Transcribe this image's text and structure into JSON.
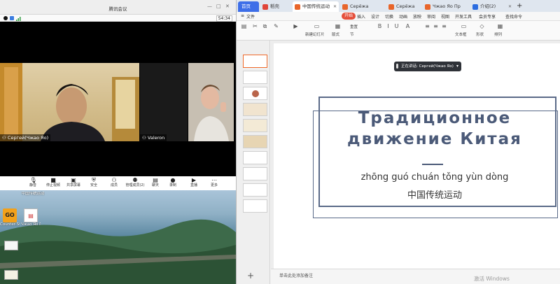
{
  "meeting": {
    "title": "腾讯会议",
    "timer": "54:34",
    "participants": [
      {
        "name": "Сергей(Чжао Яо)"
      },
      {
        "name": "Valeron"
      }
    ],
    "toolbar": [
      {
        "label": "静音",
        "icon": "microphone-icon"
      },
      {
        "label": "停止视频",
        "icon": "camera-icon"
      },
      {
        "label": "共享屏幕",
        "icon": "share-screen-icon"
      },
      {
        "label": "安全",
        "icon": "shield-icon"
      },
      {
        "label": "成员",
        "icon": "members-icon"
      },
      {
        "label": "管理成员(2)",
        "icon": "manage-members-icon"
      },
      {
        "label": "聊天",
        "icon": "chat-icon"
      },
      {
        "label": "录制",
        "icon": "record-icon"
      },
      {
        "label": "直播",
        "icon": "live-icon"
      },
      {
        "label": "更多",
        "icon": "more-icon"
      }
    ]
  },
  "desktop": {
    "icons": [
      {
        "label": "中国传统运动",
        "kind": "ppt-file-icon"
      },
      {
        "label": "Counter-Strike Global Off...",
        "kind": "game-icon"
      },
      {
        "label": "Чжао Яо Проект...",
        "kind": "document-icon"
      }
    ]
  },
  "presentation": {
    "tabs": [
      {
        "label": "首页"
      },
      {
        "label": "稻壳"
      },
      {
        "label": "中国传统运动"
      },
      {
        "label": "Серёжа"
      },
      {
        "label": "Серёжа"
      },
      {
        "label": "Чжао Яо Пр"
      },
      {
        "label": "介绍(2)"
      }
    ],
    "menu": [
      "文件",
      "开始",
      "插入",
      "设计",
      "切换",
      "动画",
      "放映",
      "审阅",
      "视图",
      "开发工具",
      "会员专享",
      "查找命令"
    ],
    "ribbon": {
      "new_slide": "新建幻灯片",
      "layout": "版式",
      "section": "节",
      "reset": "重置",
      "text_box": "文本框",
      "shape": "形状",
      "arrange": "排列"
    },
    "share_banner": "正在讲话: Сергей(Чжао Яо)",
    "slide": {
      "title_line1": "Традиционное",
      "title_line2": "движение Китая",
      "pinyin": "zhōng guó chuán tǒng yùn dòng",
      "chinese": "中国传统运动"
    },
    "notes_hint": "单击此处添加备注",
    "watermark": "激活 Windows",
    "slide_count": 10,
    "selected_slide": 1
  },
  "colors": {
    "accent_blue": "#3d6ee8",
    "start_tab_red": "#e54f3b",
    "slide_title": "#4b5a78",
    "frame": "#5a6a88"
  }
}
